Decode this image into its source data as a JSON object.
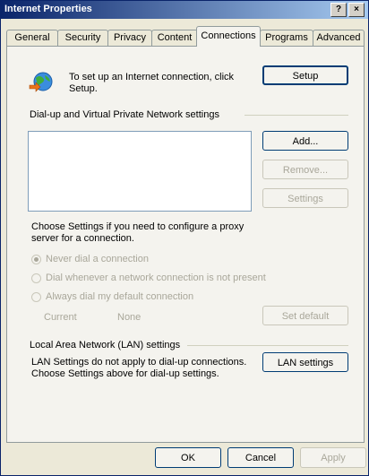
{
  "window": {
    "title": "Internet Properties",
    "help_label": "?",
    "close_label": "×"
  },
  "tabs": [
    {
      "label": "General"
    },
    {
      "label": "Security"
    },
    {
      "label": "Privacy"
    },
    {
      "label": "Content"
    },
    {
      "label": "Connections",
      "active": true
    },
    {
      "label": "Programs"
    },
    {
      "label": "Advanced"
    }
  ],
  "setup": {
    "text": "To set up an Internet connection, click Setup.",
    "button_label": "Setup"
  },
  "dialup": {
    "group_label": "Dial-up and Virtual Private Network settings",
    "add_label": "Add...",
    "remove_label": "Remove...",
    "settings_label": "Settings",
    "proxy_text": "Choose Settings if you need to configure a proxy server for a connection.",
    "radios": [
      {
        "label": "Never dial a connection",
        "checked": true
      },
      {
        "label": "Dial whenever a network connection is not present",
        "checked": false
      },
      {
        "label": "Always dial my default connection",
        "checked": false
      }
    ],
    "current_label": "Current",
    "current_value": "None",
    "set_default_label": "Set default"
  },
  "lan": {
    "group_label": "Local Area Network (LAN) settings",
    "text": "LAN Settings do not apply to dial-up connections. Choose Settings above for dial-up settings.",
    "button_label": "LAN settings"
  },
  "footer": {
    "ok_label": "OK",
    "cancel_label": "Cancel",
    "apply_label": "Apply"
  }
}
